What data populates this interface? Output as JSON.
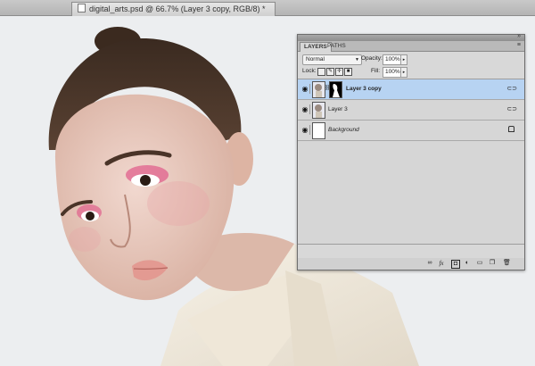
{
  "document_tab": {
    "title": "digital_arts.psd @ 66.7% (Layer 3 copy, RGB/8) *"
  },
  "layers_panel": {
    "tabs": [
      {
        "label": "LAYERS"
      },
      {
        "label": "PATHS"
      }
    ],
    "blend_mode": "Normal",
    "opacity_label": "Opacity:",
    "opacity_value": "100%",
    "lock_label": "Lock:",
    "fill_label": "Fill:",
    "fill_value": "100%",
    "layers": [
      {
        "name": "Layer 3 copy",
        "selected": true,
        "visible": true
      },
      {
        "name": "Layer 3",
        "selected": false,
        "visible": true
      },
      {
        "name": "Background",
        "selected": false,
        "visible": true,
        "locked": true
      }
    ],
    "bottom_icons": [
      "link-layers-icon",
      "fx-icon",
      "add-mask-icon",
      "adjustment-layer-icon",
      "new-group-icon",
      "new-layer-icon",
      "trash-icon"
    ],
    "selection_color": "#b7d3f2"
  }
}
